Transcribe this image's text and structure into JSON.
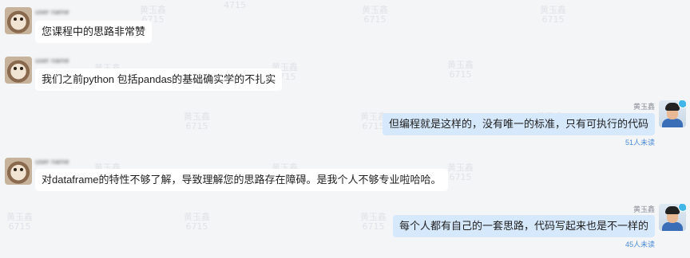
{
  "watermark": {
    "line1": "黄玉鑫",
    "line2": "6715",
    "short": "4715"
  },
  "messages": [
    {
      "direction": "incoming",
      "sender": "user name",
      "text": "您课程中的思路非常赞"
    },
    {
      "direction": "incoming",
      "sender": "user name",
      "text": "我们之前python 包括pandas的基础确实学的不扎实"
    },
    {
      "direction": "outgoing",
      "sender": "黄玉鑫",
      "text": "但编程就是这样的，没有唯一的标准，只有可执行的代码",
      "receipt": "51人未读"
    },
    {
      "direction": "incoming",
      "sender": "user name",
      "text": "对dataframe的特性不够了解，导致理解您的思路存在障碍。是我个人不够专业啦哈哈。"
    },
    {
      "direction": "outgoing",
      "sender": "黄玉鑫",
      "text": "每个人都有自己的一套思路，代码写起来也是不一样的",
      "receipt": "45人未读"
    }
  ],
  "colors": {
    "background": "#f4f5f7",
    "incoming_bubble": "#ffffff",
    "outgoing_bubble": "#d6e8fb",
    "receipt": "#4a8ad8"
  },
  "icons": {
    "avatar_incoming": "dog-avatar-icon",
    "avatar_outgoing": "man-avatar-icon"
  }
}
